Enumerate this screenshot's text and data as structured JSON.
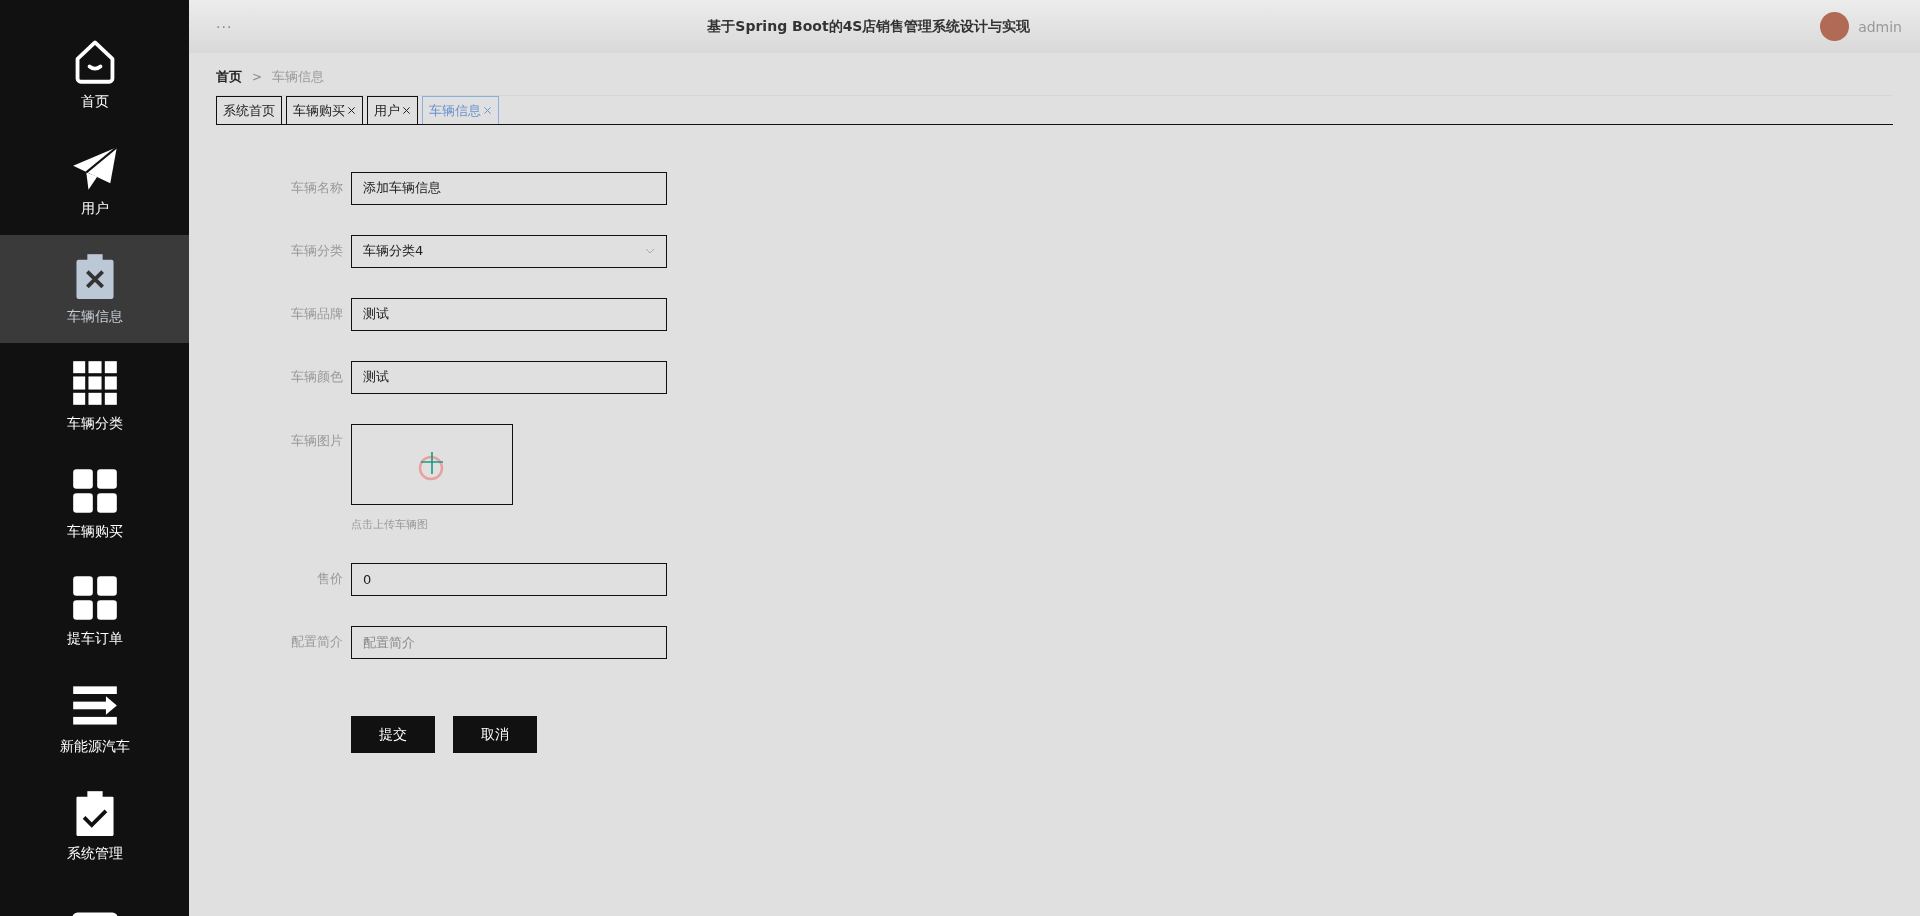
{
  "sidebar": {
    "items": [
      {
        "label": "首页",
        "kind": "home",
        "selected": false
      },
      {
        "label": "用户",
        "kind": "plane",
        "selected": false
      },
      {
        "label": "车辆信息",
        "kind": "clipboard-x",
        "selected": true
      },
      {
        "label": "车辆分类",
        "kind": "grid9",
        "selected": false
      },
      {
        "label": "车辆购买",
        "kind": "grid4",
        "selected": false
      },
      {
        "label": "提车订单",
        "kind": "grid4",
        "selected": false
      },
      {
        "label": "新能源汽车",
        "kind": "lines",
        "selected": false
      },
      {
        "label": "系统管理",
        "kind": "clipboard-check",
        "selected": false
      },
      {
        "kind": "monitor",
        "selected": false
      }
    ]
  },
  "header": {
    "menu": "···",
    "title": "基于Spring Boot的4S店销售管理系统设计与实现",
    "user": "admin"
  },
  "breadcrumb": {
    "separator": ">",
    "items": [
      "首页",
      "车辆信息"
    ]
  },
  "tabs": [
    {
      "label": "系统首页",
      "closable": false,
      "selected": false
    },
    {
      "label": "车辆购买",
      "closable": true,
      "selected": false
    },
    {
      "label": "用户",
      "closable": true,
      "selected": false
    },
    {
      "label": "车辆信息",
      "closable": true,
      "selected": true
    }
  ],
  "form": {
    "fields": [
      {
        "kind": "text",
        "label": "车辆名称",
        "value": "添加车辆信息"
      },
      {
        "kind": "select",
        "label": "车辆分类",
        "value": "车辆分类4"
      },
      {
        "kind": "text",
        "label": "车辆品牌",
        "value": "测试"
      },
      {
        "kind": "text",
        "label": "车辆颜色",
        "value": "测试"
      },
      {
        "kind": "upload",
        "label": "车辆图片",
        "hint": "点击上传车辆图"
      },
      {
        "kind": "text",
        "label": "售价",
        "value": "0"
      },
      {
        "kind": "text",
        "label": "配置简介",
        "placeholder": "配置简介"
      }
    ],
    "buttons": [
      "提交",
      "取消"
    ]
  }
}
